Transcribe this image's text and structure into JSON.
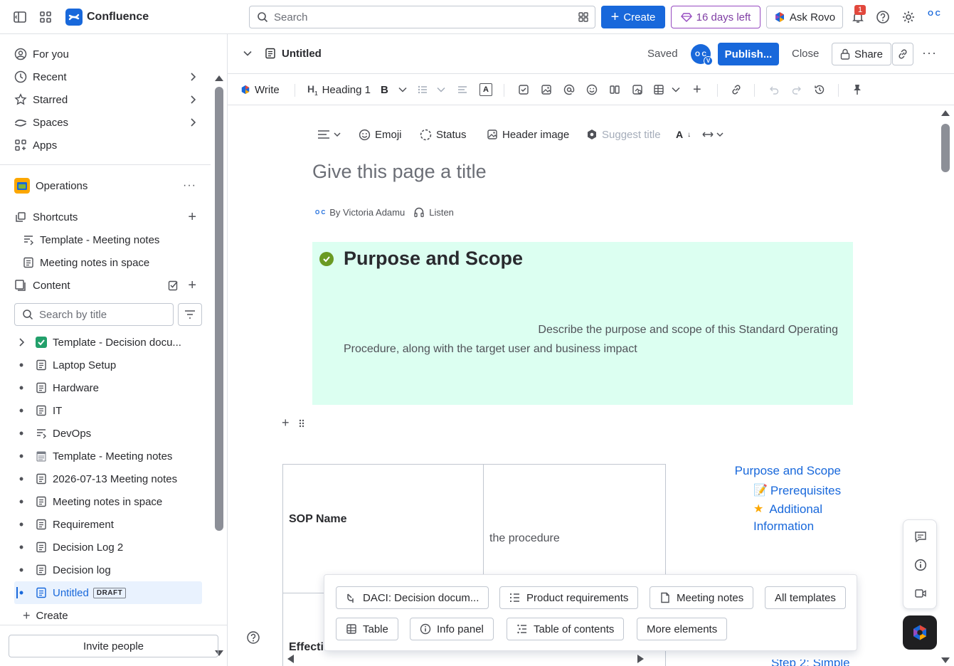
{
  "topbar": {
    "app_name": "Confluence",
    "search_placeholder": "Search",
    "create_label": "Create",
    "trial_label": "16 days left",
    "rovo_label": "Ask Rovo",
    "notification_count": "1",
    "avatar_initials": "O C"
  },
  "sidebar": {
    "nav": [
      {
        "label": "For you"
      },
      {
        "label": "Recent"
      },
      {
        "label": "Starred"
      },
      {
        "label": "Spaces"
      },
      {
        "label": "Apps"
      }
    ],
    "space_name": "Operations",
    "shortcuts_label": "Shortcuts",
    "shortcuts": [
      "Template - Meeting notes",
      "Meeting notes in space"
    ],
    "content_label": "Content",
    "search_placeholder": "Search by title",
    "tree": [
      {
        "label": "Template - Decision docu...",
        "icon": "check-emoji-icon"
      },
      {
        "label": "Laptop Setup",
        "icon": "page-icon"
      },
      {
        "label": "Hardware",
        "icon": "page-icon"
      },
      {
        "label": "IT",
        "icon": "page-icon"
      },
      {
        "label": "DevOps",
        "icon": "live-doc-icon"
      },
      {
        "label": "Template - Meeting notes",
        "icon": "notepad-emoji-icon"
      },
      {
        "label": "2026-07-13 Meeting notes",
        "icon": "page-icon"
      },
      {
        "label": "Meeting notes in space",
        "icon": "page-icon"
      },
      {
        "label": "Requirement",
        "icon": "page-icon"
      },
      {
        "label": "Decision Log 2",
        "icon": "page-icon"
      },
      {
        "label": "Decision log",
        "icon": "page-icon"
      },
      {
        "label": "Untitled",
        "icon": "page-icon",
        "badge": "DRAFT",
        "active": true
      }
    ],
    "create_label": "Create",
    "invite_label": "Invite people"
  },
  "page_header": {
    "title": "Untitled",
    "saved_label": "Saved",
    "avatar_initials": "O C",
    "avatar_badge": "V",
    "publish_label": "Publish...",
    "close_label": "Close",
    "share_label": "Share"
  },
  "toolbar": {
    "write_label": "Write",
    "heading_label": "Heading 1"
  },
  "meta_toolbar": {
    "emoji_label": "Emoji",
    "status_label": "Status",
    "header_image_label": "Header image",
    "suggest_title_label": "Suggest title"
  },
  "page": {
    "title_placeholder": "Give this page a title",
    "byline": "By Victoria Adamu",
    "listen_label": "Listen",
    "panel_title": "Purpose and Scope",
    "panel_desc_line1": "Describe the purpose and scope of this Standard Operating",
    "panel_desc_line2": "Procedure, along with the target user and business impact",
    "table": {
      "row1_label": "SOP Name",
      "row1_value": "the procedure",
      "row2_label": "Effecti"
    },
    "toc": {
      "item1": "Purpose and Scope",
      "item2": "Prerequisites",
      "item3_line1": "Additional",
      "item3_line2": "Information",
      "item4": "Step 2: Simple"
    }
  },
  "element_panel": {
    "chips_row1": [
      "DACI: Decision docum...",
      "Product requirements",
      "Meeting notes",
      "All templates"
    ],
    "chips_row2": [
      "Table",
      "Info panel",
      "Table of contents",
      "More elements"
    ]
  },
  "colors": {
    "brand_blue": "#1868db",
    "panel_green": "#dcfff1",
    "success_green": "#22a06b",
    "trial_purple": "#964ac0"
  }
}
